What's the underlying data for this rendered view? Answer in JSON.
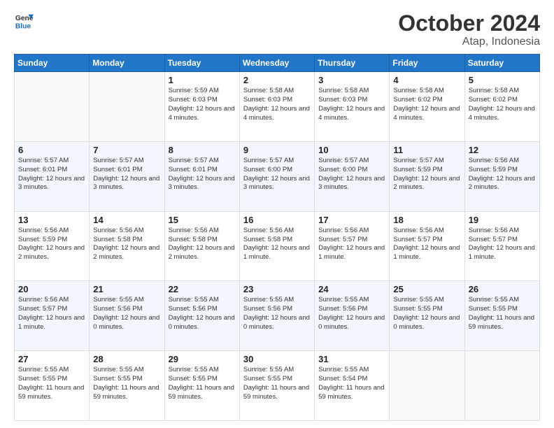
{
  "logo": {
    "line1": "General",
    "line2": "Blue"
  },
  "header": {
    "month": "October 2024",
    "location": "Atap, Indonesia"
  },
  "days_of_week": [
    "Sunday",
    "Monday",
    "Tuesday",
    "Wednesday",
    "Thursday",
    "Friday",
    "Saturday"
  ],
  "weeks": [
    [
      {
        "day": "",
        "info": ""
      },
      {
        "day": "",
        "info": ""
      },
      {
        "day": "1",
        "info": "Sunrise: 5:59 AM\nSunset: 6:03 PM\nDaylight: 12 hours and 4 minutes."
      },
      {
        "day": "2",
        "info": "Sunrise: 5:58 AM\nSunset: 6:03 PM\nDaylight: 12 hours and 4 minutes."
      },
      {
        "day": "3",
        "info": "Sunrise: 5:58 AM\nSunset: 6:03 PM\nDaylight: 12 hours and 4 minutes."
      },
      {
        "day": "4",
        "info": "Sunrise: 5:58 AM\nSunset: 6:02 PM\nDaylight: 12 hours and 4 minutes."
      },
      {
        "day": "5",
        "info": "Sunrise: 5:58 AM\nSunset: 6:02 PM\nDaylight: 12 hours and 4 minutes."
      }
    ],
    [
      {
        "day": "6",
        "info": "Sunrise: 5:57 AM\nSunset: 6:01 PM\nDaylight: 12 hours and 3 minutes."
      },
      {
        "day": "7",
        "info": "Sunrise: 5:57 AM\nSunset: 6:01 PM\nDaylight: 12 hours and 3 minutes."
      },
      {
        "day": "8",
        "info": "Sunrise: 5:57 AM\nSunset: 6:01 PM\nDaylight: 12 hours and 3 minutes."
      },
      {
        "day": "9",
        "info": "Sunrise: 5:57 AM\nSunset: 6:00 PM\nDaylight: 12 hours and 3 minutes."
      },
      {
        "day": "10",
        "info": "Sunrise: 5:57 AM\nSunset: 6:00 PM\nDaylight: 12 hours and 3 minutes."
      },
      {
        "day": "11",
        "info": "Sunrise: 5:57 AM\nSunset: 5:59 PM\nDaylight: 12 hours and 2 minutes."
      },
      {
        "day": "12",
        "info": "Sunrise: 5:56 AM\nSunset: 5:59 PM\nDaylight: 12 hours and 2 minutes."
      }
    ],
    [
      {
        "day": "13",
        "info": "Sunrise: 5:56 AM\nSunset: 5:59 PM\nDaylight: 12 hours and 2 minutes."
      },
      {
        "day": "14",
        "info": "Sunrise: 5:56 AM\nSunset: 5:58 PM\nDaylight: 12 hours and 2 minutes."
      },
      {
        "day": "15",
        "info": "Sunrise: 5:56 AM\nSunset: 5:58 PM\nDaylight: 12 hours and 2 minutes."
      },
      {
        "day": "16",
        "info": "Sunrise: 5:56 AM\nSunset: 5:58 PM\nDaylight: 12 hours and 1 minute."
      },
      {
        "day": "17",
        "info": "Sunrise: 5:56 AM\nSunset: 5:57 PM\nDaylight: 12 hours and 1 minute."
      },
      {
        "day": "18",
        "info": "Sunrise: 5:56 AM\nSunset: 5:57 PM\nDaylight: 12 hours and 1 minute."
      },
      {
        "day": "19",
        "info": "Sunrise: 5:56 AM\nSunset: 5:57 PM\nDaylight: 12 hours and 1 minute."
      }
    ],
    [
      {
        "day": "20",
        "info": "Sunrise: 5:56 AM\nSunset: 5:57 PM\nDaylight: 12 hours and 1 minute."
      },
      {
        "day": "21",
        "info": "Sunrise: 5:55 AM\nSunset: 5:56 PM\nDaylight: 12 hours and 0 minutes."
      },
      {
        "day": "22",
        "info": "Sunrise: 5:55 AM\nSunset: 5:56 PM\nDaylight: 12 hours and 0 minutes."
      },
      {
        "day": "23",
        "info": "Sunrise: 5:55 AM\nSunset: 5:56 PM\nDaylight: 12 hours and 0 minutes."
      },
      {
        "day": "24",
        "info": "Sunrise: 5:55 AM\nSunset: 5:56 PM\nDaylight: 12 hours and 0 minutes."
      },
      {
        "day": "25",
        "info": "Sunrise: 5:55 AM\nSunset: 5:55 PM\nDaylight: 12 hours and 0 minutes."
      },
      {
        "day": "26",
        "info": "Sunrise: 5:55 AM\nSunset: 5:55 PM\nDaylight: 11 hours and 59 minutes."
      }
    ],
    [
      {
        "day": "27",
        "info": "Sunrise: 5:55 AM\nSunset: 5:55 PM\nDaylight: 11 hours and 59 minutes."
      },
      {
        "day": "28",
        "info": "Sunrise: 5:55 AM\nSunset: 5:55 PM\nDaylight: 11 hours and 59 minutes."
      },
      {
        "day": "29",
        "info": "Sunrise: 5:55 AM\nSunset: 5:55 PM\nDaylight: 11 hours and 59 minutes."
      },
      {
        "day": "30",
        "info": "Sunrise: 5:55 AM\nSunset: 5:55 PM\nDaylight: 11 hours and 59 minutes."
      },
      {
        "day": "31",
        "info": "Sunrise: 5:55 AM\nSunset: 5:54 PM\nDaylight: 11 hours and 59 minutes."
      },
      {
        "day": "",
        "info": ""
      },
      {
        "day": "",
        "info": ""
      }
    ]
  ]
}
